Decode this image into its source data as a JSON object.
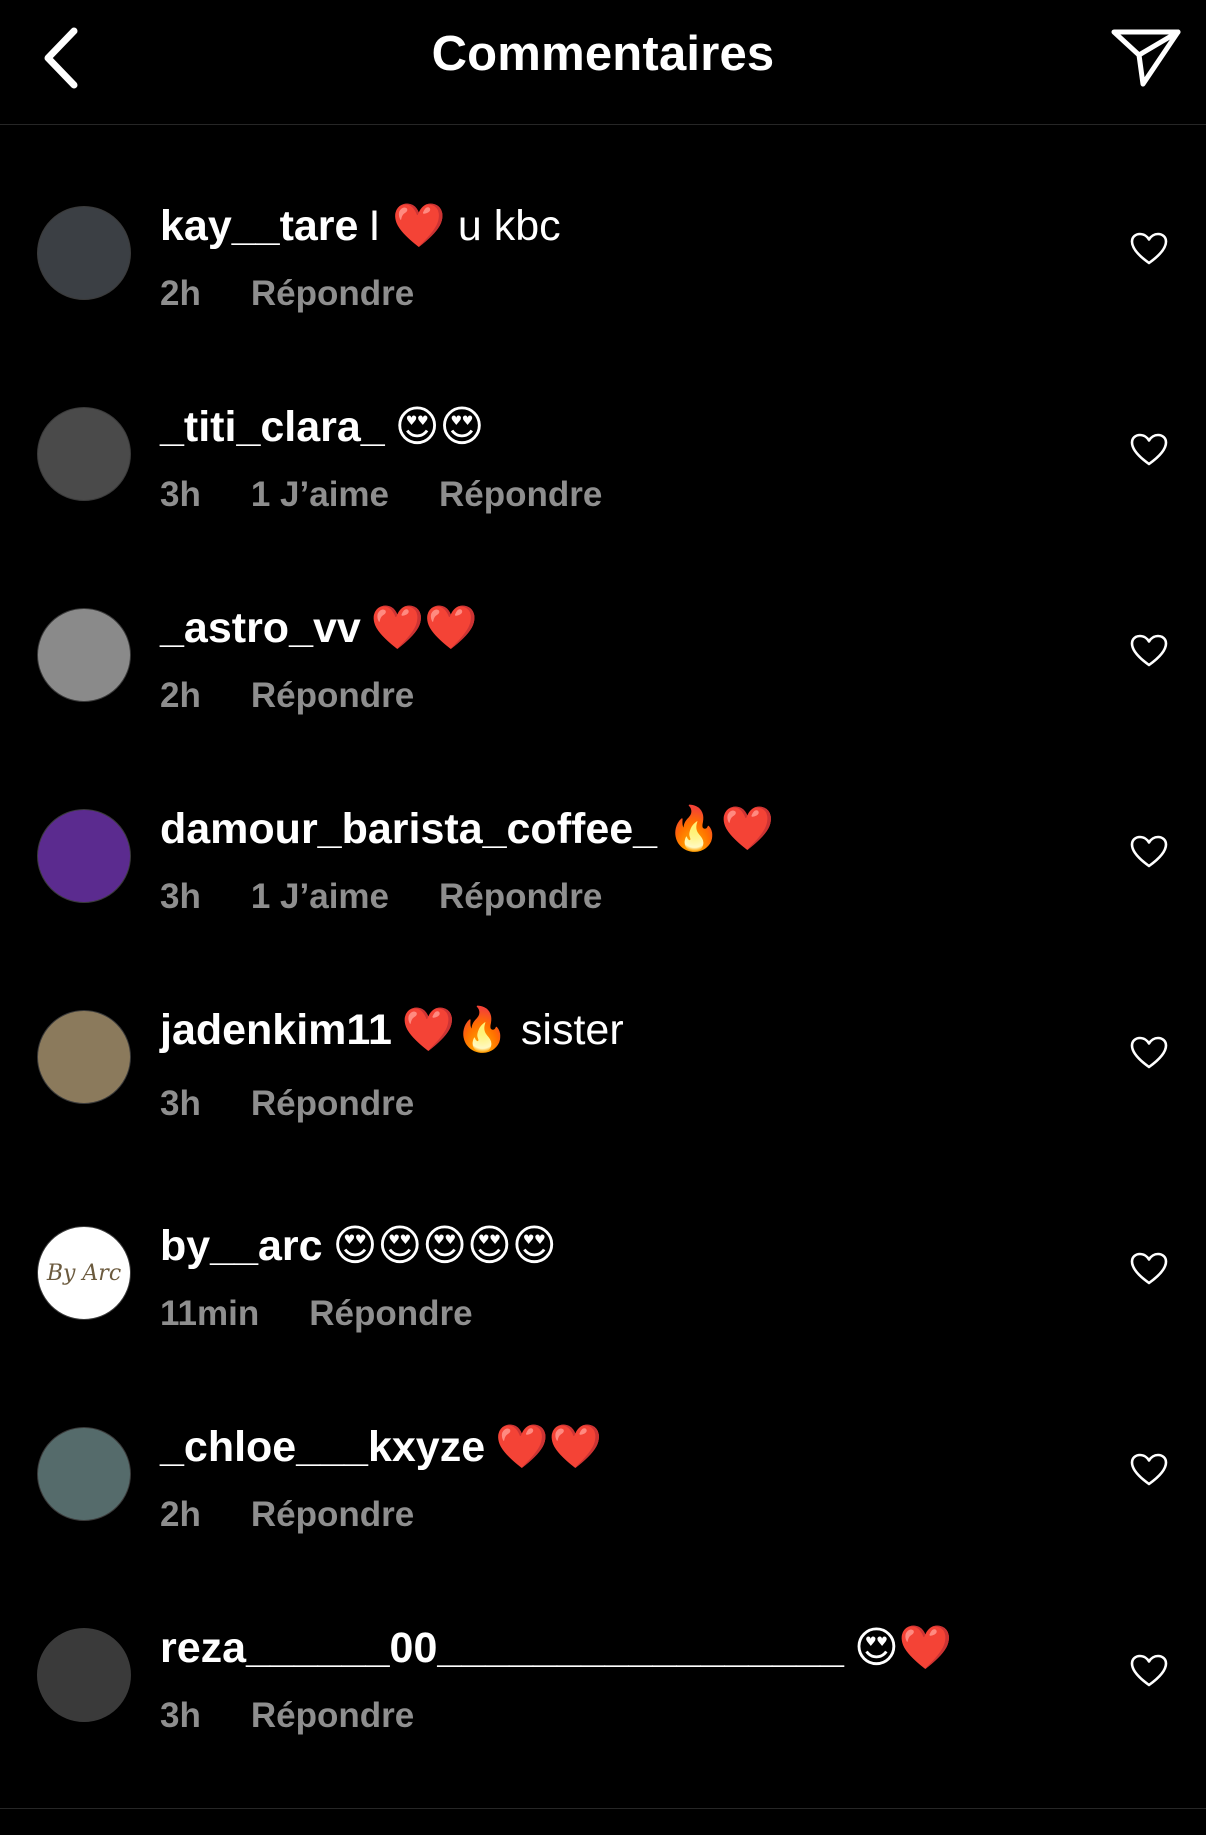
{
  "header": {
    "title": "Commentaires",
    "back_icon": "chevron-left-icon",
    "share_icon": "paper-plane-icon"
  },
  "colors": {
    "background": "#000000",
    "text": "#ffffff",
    "meta_text": "#8e8e8e",
    "divider": "#262626"
  },
  "comments": [
    {
      "username": "kay__tare",
      "text": "I ❤️ u kbc",
      "time": "2h",
      "likes": "",
      "reply": "Répondre",
      "avatar_bg": "#3b3f44"
    },
    {
      "username": "_titi_clara_",
      "text": "😍😍",
      "time": "3h",
      "likes": "1 J’aime",
      "reply": "Répondre",
      "avatar_bg": "#4a4a4a"
    },
    {
      "username": "_astro_vv",
      "text": "❤️❤️",
      "time": "2h",
      "likes": "",
      "reply": "Répondre",
      "avatar_bg": "#8a8a8a"
    },
    {
      "username": "damour_barista_coffee_",
      "text": "🔥❤️",
      "time": "3h",
      "likes": "1 J’aime",
      "reply": "Répondre",
      "avatar_bg": "#5b2b8f"
    },
    {
      "username": "jadenkim11",
      "text": "❤️🔥 sister",
      "time": "3h",
      "likes": "",
      "reply": "Répondre",
      "avatar_bg": "#8b7a5c"
    },
    {
      "username": "by__arc",
      "text": "😍😍😍😍😍",
      "time": "11min",
      "likes": "",
      "reply": "Répondre",
      "avatar_bg": "#ffffff",
      "avatar_text": "By Arc"
    },
    {
      "username": "_chloe___kxyze",
      "text": "❤️❤️",
      "time": "2h",
      "likes": "",
      "reply": "Répondre",
      "avatar_bg": "#556b6b"
    },
    {
      "username": "reza______00_________________",
      "text": "😍❤️",
      "time": "3h",
      "likes": "",
      "reply": "Répondre",
      "avatar_bg": "#3a3a3a"
    }
  ]
}
